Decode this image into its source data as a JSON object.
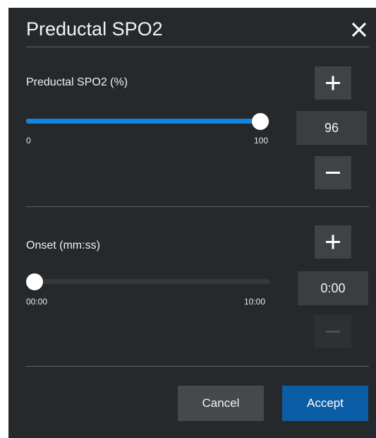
{
  "dialog": {
    "title": "Preductal SPO2",
    "close_icon": "close-icon"
  },
  "spo2": {
    "label": "Preductal SPO2 (%)",
    "value": "96",
    "min_label": "0",
    "max_label": "100",
    "level_fraction": 0.96,
    "increment_icon": "plus-icon",
    "decrement_icon": "minus-icon"
  },
  "onset": {
    "label": "Onset (mm:ss)",
    "value": "0:00",
    "min_label": "00:00",
    "max_label": "10:00",
    "level_fraction": 0.0,
    "increment_icon": "plus-icon",
    "decrement_icon": "minus-icon",
    "decrement_enabled": false
  },
  "actions": {
    "cancel_label": "Cancel",
    "accept_label": "Accept"
  },
  "colors": {
    "background": "#26292c",
    "accent": "#1185dc",
    "accept_button": "#0b5ea6",
    "button": "#3f4346"
  }
}
